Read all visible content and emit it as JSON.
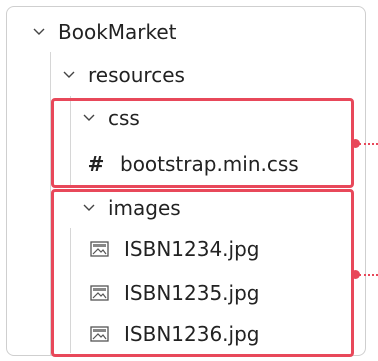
{
  "explorer": {
    "root": {
      "label": "BookMarket",
      "expanded": true,
      "icon": "chevron-down-icon"
    },
    "resources": {
      "label": "resources",
      "expanded": true,
      "icon": "chevron-down-icon"
    },
    "css_folder": {
      "label": "css",
      "expanded": true,
      "icon": "chevron-down-icon",
      "files": [
        {
          "label": "bootstrap.min.css",
          "icon": "hash-icon",
          "glyph": "#"
        }
      ]
    },
    "images_folder": {
      "label": "images",
      "expanded": true,
      "icon": "chevron-down-icon",
      "files": [
        {
          "label": "ISBN1234.jpg",
          "icon": "image-file-icon"
        },
        {
          "label": "ISBN1235.jpg",
          "icon": "image-file-icon"
        },
        {
          "label": "ISBN1236.jpg",
          "icon": "image-file-icon"
        }
      ]
    }
  },
  "colors": {
    "highlight": "#e8485a",
    "border": "#cfcfcf",
    "text": "#222222"
  }
}
